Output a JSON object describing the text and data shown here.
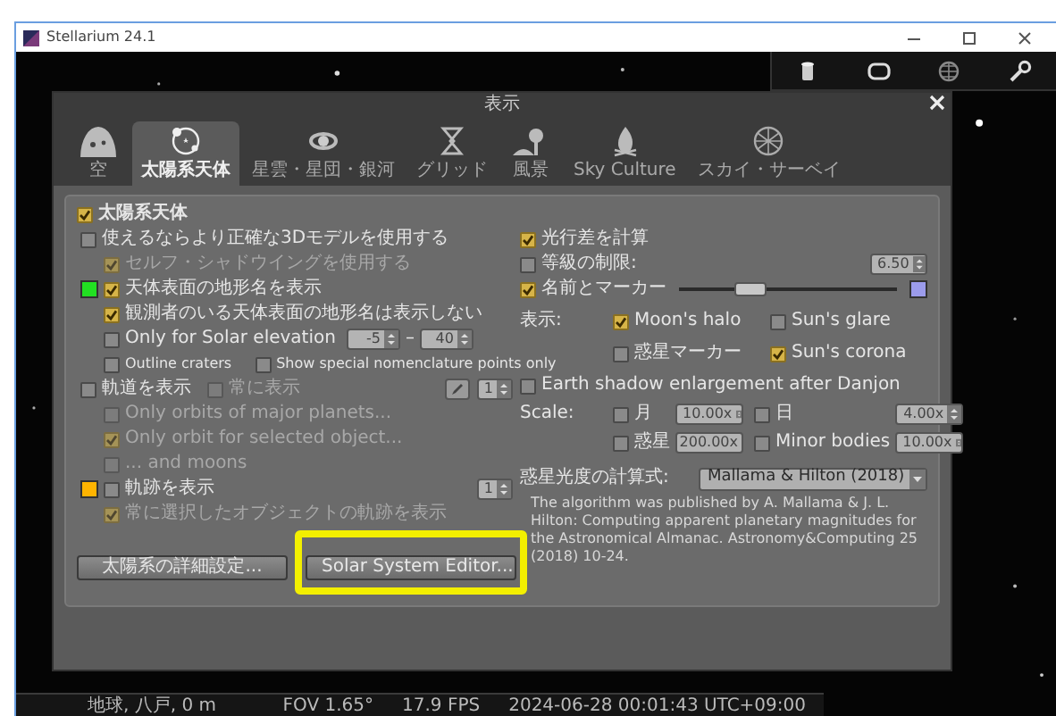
{
  "window": {
    "title": "Stellarium 24.1"
  },
  "dialog": {
    "title": "表示"
  },
  "tabs": [
    {
      "kind": "sky",
      "label": "空",
      "selected": false
    },
    {
      "kind": "solar",
      "label": "太陽系天体",
      "selected": true
    },
    {
      "kind": "deepsky",
      "label": "星雲・星団・銀河",
      "selected": false
    },
    {
      "kind": "grid",
      "label": "グリッド",
      "selected": false
    },
    {
      "kind": "landscape",
      "label": "風景",
      "selected": false
    },
    {
      "kind": "culture",
      "label": "Sky Culture",
      "selected": false
    },
    {
      "kind": "survey",
      "label": "スカイ・サーベイ",
      "selected": false
    }
  ],
  "solar_system": {
    "label": "太陽系天体",
    "checked": true,
    "options": [
      {
        "kind": "check",
        "label": "使えるならより正確な3Dモデルを使用する",
        "checked": false,
        "disabled": false,
        "children": [
          {
            "kind": "check",
            "label": "セルフ・シャドウイングを使用する",
            "checked": true,
            "disabled": true
          }
        ]
      },
      {
        "kind": "check",
        "color": "#22e022",
        "label": "天体表面の地形名を表示",
        "checked": true,
        "disabled": false,
        "children": [
          {
            "kind": "check",
            "label": "観測者のいる天体表面の地形名は表示しない",
            "checked": true,
            "disabled": false
          },
          {
            "kind": "range",
            "label": "Only for Solar elevation",
            "checked": false,
            "disabled": false,
            "from": "-5",
            "separator": "–",
            "to": "40"
          },
          {
            "kind": "pair",
            "items": [
              {
                "label": "Outline craters",
                "checked": false
              },
              {
                "label": "Show special nomenclature points only",
                "checked": false
              }
            ]
          }
        ]
      },
      {
        "kind": "check",
        "label": "軌道を表示",
        "checked": false,
        "disabled": false,
        "also": {
          "label": "常に表示",
          "checked": false,
          "disabled": true
        },
        "edit_button": true,
        "spin": "1",
        "children": [
          {
            "kind": "check",
            "label": "Only orbits of major planets...",
            "checked": false,
            "disabled": true
          },
          {
            "kind": "check",
            "label": "Only orbit for selected object...",
            "checked": true,
            "disabled": true
          },
          {
            "kind": "check",
            "label": "... and moons",
            "checked": false,
            "disabled": true
          }
        ]
      },
      {
        "kind": "check",
        "color": "#ffb400",
        "label": "軌跡を表示",
        "checked": false,
        "disabled": false,
        "spin": "1",
        "children": [
          {
            "kind": "check",
            "label": "常に選択したオブジェクトの軌跡を表示",
            "checked": true,
            "disabled": true
          }
        ]
      }
    ],
    "buttons": [
      {
        "label": "太陽系の詳細設定...",
        "highlighted": false
      },
      {
        "label": "Solar System Editor...",
        "highlighted": true
      }
    ]
  },
  "aberration": {
    "label": "光行差を計算",
    "checked": true
  },
  "magnitude_limit": {
    "label": "等級の制限:",
    "checked": false,
    "value": "6.50"
  },
  "labels": {
    "label": "名前とマーカー",
    "checked": true,
    "level": 0.33,
    "color": "#9c9cec"
  },
  "display": {
    "label": "表示:",
    "options": [
      {
        "label": "Moon's halo",
        "checked": true
      },
      {
        "label": "Sun's glare",
        "checked": false
      },
      {
        "label": "惑星マーカー",
        "checked": false
      },
      {
        "label": "Sun's corona",
        "checked": true
      }
    ]
  },
  "earth_shadow": {
    "label": "Earth shadow enlargement after Danjon",
    "checked": false
  },
  "scale": {
    "label": "Scale:",
    "items": [
      {
        "label": "月",
        "checked": false,
        "value": "10.00x"
      },
      {
        "label": "日",
        "checked": false,
        "value": "4.00x"
      },
      {
        "label": "惑星",
        "checked": false,
        "value": "200.00x"
      },
      {
        "label": "Minor bodies",
        "checked": false,
        "value": "10.00x"
      }
    ]
  },
  "magnitude_algorithm": {
    "label": "惑星光度の計算式:",
    "value": "Mallama & Hilton (2018)",
    "description": "The algorithm was published by A. Mallama & J. L. Hilton: Computing apparent planetary magnitudes for the Astronomical Almanac. Astronomy&Computing 25 (2018) 10-24."
  },
  "status_bar": {
    "location": "地球, 八戸, 0 m",
    "fov": "FOV 1.65°",
    "fps": "17.9 FPS",
    "datetime": "2024-06-28 00:01:43 UTC+09:00"
  }
}
